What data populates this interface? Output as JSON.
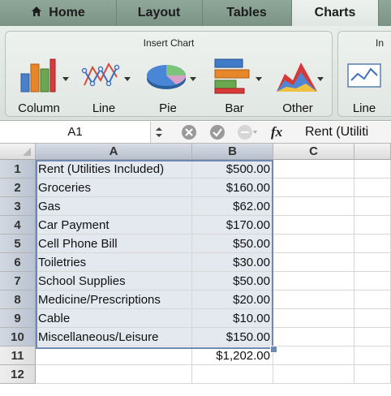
{
  "tabs": [
    {
      "label": "Home",
      "icon": "home-icon"
    },
    {
      "label": "Layout"
    },
    {
      "label": "Tables"
    },
    {
      "label": "Charts",
      "active": true
    }
  ],
  "ribbon": {
    "group_title": "Insert Chart",
    "group2_title": "In",
    "buttons": [
      {
        "label": "Column",
        "icon": "column-chart-icon"
      },
      {
        "label": "Line",
        "icon": "line-chart-icon"
      },
      {
        "label": "Pie",
        "icon": "pie-chart-icon"
      },
      {
        "label": "Bar",
        "icon": "bar-chart-icon"
      },
      {
        "label": "Other",
        "icon": "other-chart-icon"
      },
      {
        "label": "Line",
        "icon": "sparkline-icon"
      }
    ]
  },
  "formula_bar": {
    "name_box": "A1",
    "fx_label": "fx",
    "content": "Rent (Utiliti"
  },
  "sheet": {
    "columns": [
      "A",
      "B",
      "C"
    ],
    "rows": [
      {
        "num": "1",
        "a": "Rent (Utilities Included)",
        "b": "$500.00"
      },
      {
        "num": "2",
        "a": "Groceries",
        "b": "$160.00"
      },
      {
        "num": "3",
        "a": "Gas",
        "b": "$62.00"
      },
      {
        "num": "4",
        "a": "Car Payment",
        "b": "$170.00"
      },
      {
        "num": "5",
        "a": "Cell Phone Bill",
        "b": "$50.00"
      },
      {
        "num": "6",
        "a": "Toiletries",
        "b": "$30.00"
      },
      {
        "num": "7",
        "a": "School Supplies",
        "b": "$50.00"
      },
      {
        "num": "8",
        "a": "Medicine/Prescriptions",
        "b": "$20.00"
      },
      {
        "num": "9",
        "a": "Cable",
        "b": "$10.00"
      },
      {
        "num": "10",
        "a": "Miscellaneous/Leisure",
        "b": "$150.00"
      },
      {
        "num": "11",
        "a": "",
        "b": "$1,202.00"
      },
      {
        "num": "12",
        "a": "",
        "b": ""
      }
    ]
  }
}
